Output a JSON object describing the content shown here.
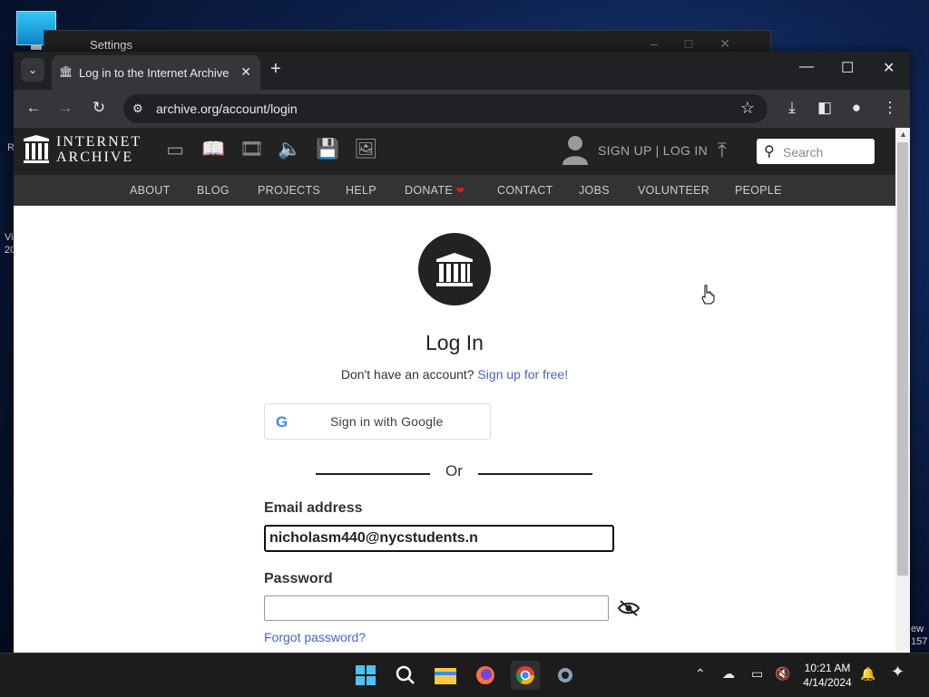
{
  "desktop": {
    "bg_window_title": "Settings",
    "edge_left_1": "R",
    "edge_left_2": "Vi",
    "edge_left_3": "20",
    "edge_right_1": "ew",
    "edge_right_2": "157"
  },
  "browser": {
    "tab_title": "Log in to the Internet Archive",
    "url": "archive.org/account/login"
  },
  "ia": {
    "wordmark_line1": "INTERNET",
    "wordmark_line2": "ARCHIVE",
    "signup_login": "SIGN UP | LOG IN",
    "search_placeholder": "Search",
    "nav": [
      "ABOUT",
      "BLOG",
      "PROJECTS",
      "HELP",
      "DONATE",
      "CONTACT",
      "JOBS",
      "VOLUNTEER",
      "PEOPLE"
    ]
  },
  "login": {
    "title": "Log In",
    "no_account": "Don't have an account?",
    "signup_link": "Sign up for free!",
    "google_button": "Sign in with Google",
    "or": "Or",
    "email_label": "Email address",
    "email_value": "nicholasm440@nycstudents.n",
    "password_label": "Password",
    "password_value": "",
    "forgot": "Forgot password?"
  },
  "taskbar": {
    "time": "10:21 AM",
    "date": "4/14/2024"
  },
  "colors": {
    "ia_top": "#222222",
    "ia_nav": "#333333",
    "link": "#4b64c9",
    "chrome_dark": "#202124",
    "chrome_toolbar": "#35363a"
  }
}
